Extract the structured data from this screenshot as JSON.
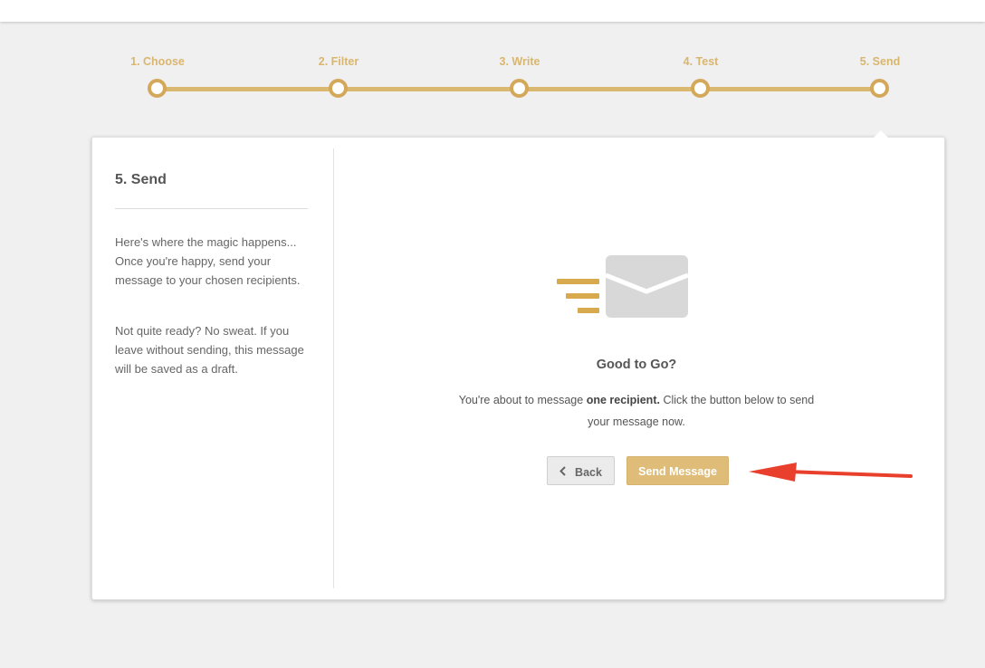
{
  "stepper": {
    "steps": [
      {
        "label": "1. Choose"
      },
      {
        "label": "2. Filter"
      },
      {
        "label": "3. Write"
      },
      {
        "label": "4. Test"
      },
      {
        "label": "5. Send"
      }
    ],
    "active_step": 5
  },
  "sidebar": {
    "title": "5. Send",
    "paragraph_1": "Here's where the magic happens... Once you're happy, send your message to your chosen recipients.",
    "paragraph_2": "Not quite ready? No sweat. If you leave without sending, this message will be saved as a draft."
  },
  "confirm": {
    "icon": "sending-envelope-icon",
    "title": "Good to Go?",
    "text_before": "You're about to message ",
    "text_bold": "one recipient.",
    "text_after": " Click the button below to send your message now."
  },
  "buttons": {
    "back_label": "Back",
    "send_label": "Send Message"
  },
  "colors": {
    "accent": "#d9b66e",
    "send_button": "#dfbd79",
    "annotation_arrow": "#e8402c"
  }
}
